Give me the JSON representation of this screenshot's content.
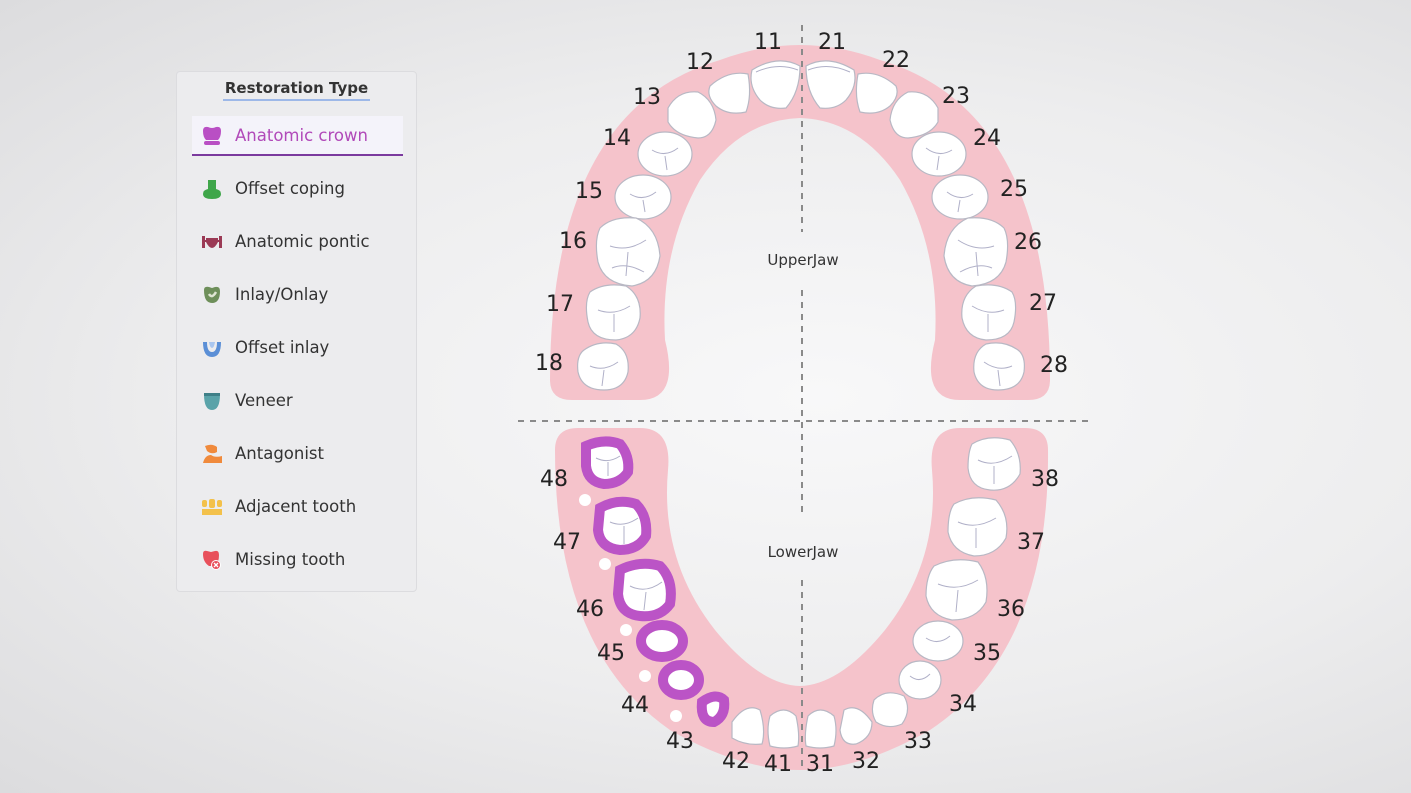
{
  "panel": {
    "title": "Restoration Type",
    "items": [
      {
        "label": "Anatomic crown",
        "icon": "anatomic-crown-icon",
        "color": "#b94fc4",
        "selected": true
      },
      {
        "label": "Offset coping",
        "icon": "offset-coping-icon",
        "color": "#3fa64a",
        "selected": false
      },
      {
        "label": "Anatomic pontic",
        "icon": "anatomic-pontic-icon",
        "color": "#9b3a55",
        "selected": false
      },
      {
        "label": "Inlay/Onlay",
        "icon": "inlay-onlay-icon",
        "color": "#6e8f5a",
        "selected": false
      },
      {
        "label": "Offset inlay",
        "icon": "offset-inlay-icon",
        "color": "#5b8fd6",
        "selected": false
      },
      {
        "label": "Veneer",
        "icon": "veneer-icon",
        "color": "#5aa3a9",
        "selected": false
      },
      {
        "label": "Antagonist",
        "icon": "antagonist-icon",
        "color": "#f08a3c",
        "selected": false
      },
      {
        "label": "Adjacent tooth",
        "icon": "adjacent-tooth-icon",
        "color": "#f3c14b",
        "selected": false
      },
      {
        "label": "Missing tooth",
        "icon": "missing-tooth-icon",
        "color": "#e8505b",
        "selected": false
      }
    ]
  },
  "jaw": {
    "upper_label": "UpperJaw",
    "lower_label": "LowerJaw",
    "gum_color": "#f5c3cb",
    "selected_color": "#bb54c6",
    "upper_teeth": [
      "11",
      "12",
      "13",
      "14",
      "15",
      "16",
      "17",
      "18",
      "21",
      "22",
      "23",
      "24",
      "25",
      "26",
      "27",
      "28"
    ],
    "lower_teeth": [
      "31",
      "32",
      "33",
      "34",
      "35",
      "36",
      "37",
      "38",
      "41",
      "42",
      "43",
      "44",
      "45",
      "46",
      "47",
      "48"
    ],
    "selected_teeth": [
      "43",
      "44",
      "45",
      "46",
      "47",
      "48"
    ]
  }
}
